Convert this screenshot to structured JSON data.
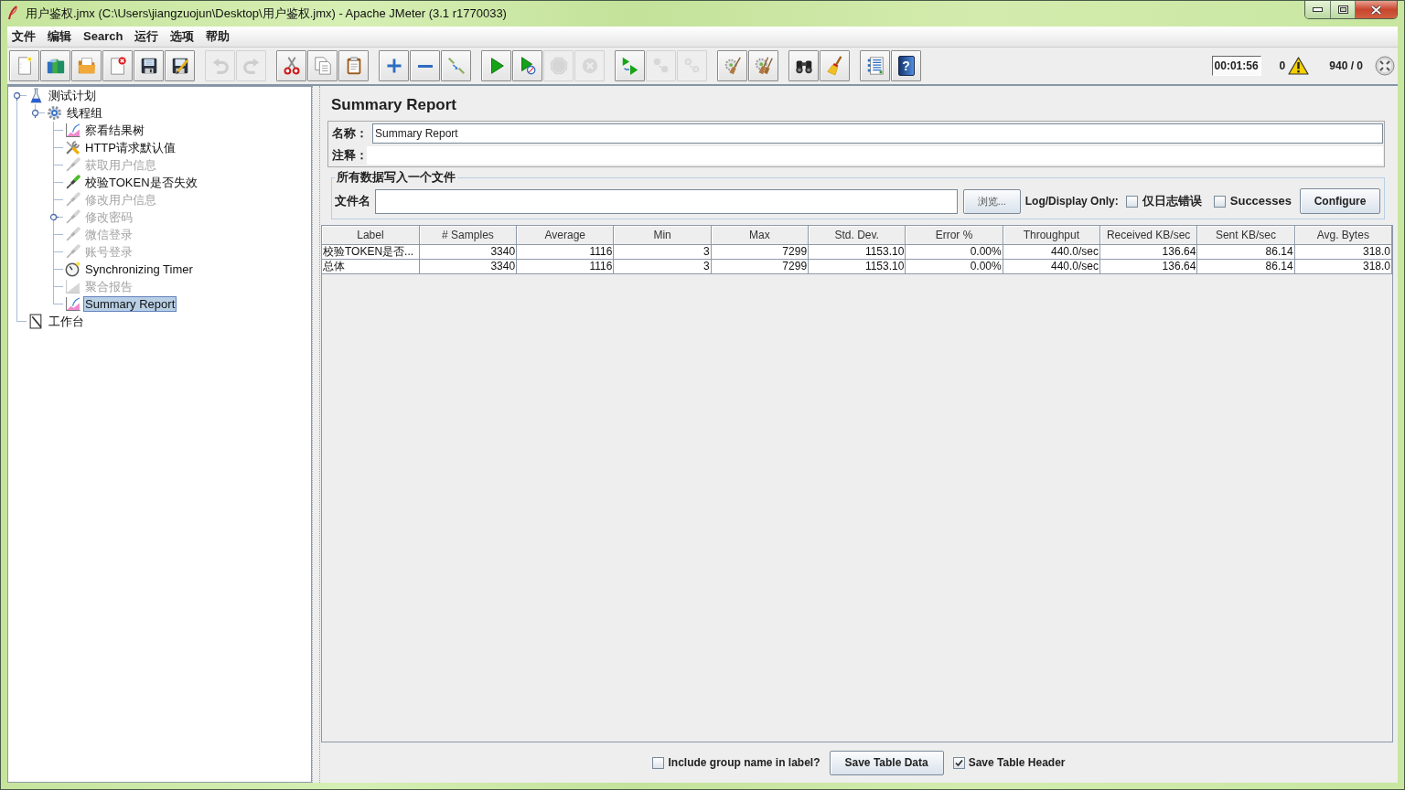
{
  "window": {
    "title": "用户鉴权.jmx (C:\\Users\\jiangzuojun\\Desktop\\用户鉴权.jmx) - Apache JMeter (3.1 r1770033)"
  },
  "menu": [
    "文件",
    "编辑",
    "Search",
    "运行",
    "选项",
    "帮助"
  ],
  "toolbar": {
    "groups": [
      [
        {
          "kind": "new",
          "disabled": false
        },
        {
          "kind": "templates",
          "disabled": false
        },
        {
          "kind": "open",
          "disabled": false
        },
        {
          "kind": "close",
          "disabled": false
        },
        {
          "kind": "save",
          "disabled": false
        },
        {
          "kind": "save_as",
          "disabled": false
        }
      ],
      [
        {
          "kind": "undo",
          "disabled": true
        },
        {
          "kind": "redo",
          "disabled": true
        }
      ],
      [
        {
          "kind": "cut",
          "disabled": false
        },
        {
          "kind": "copy",
          "disabled": false
        },
        {
          "kind": "paste",
          "disabled": false
        }
      ],
      [
        {
          "kind": "expand",
          "disabled": false
        },
        {
          "kind": "collapse",
          "disabled": false
        },
        {
          "kind": "toggle",
          "disabled": false
        }
      ],
      [
        {
          "kind": "start",
          "disabled": false
        },
        {
          "kind": "start_no_pauses",
          "disabled": false
        },
        {
          "kind": "stop",
          "disabled": true
        },
        {
          "kind": "shutdown",
          "disabled": true
        }
      ],
      [
        {
          "kind": "remote_start",
          "disabled": false
        },
        {
          "kind": "remote_stop",
          "disabled": true
        },
        {
          "kind": "remote_shutdown",
          "disabled": true
        }
      ],
      [
        {
          "kind": "clear",
          "disabled": false
        },
        {
          "kind": "clear_all",
          "disabled": false
        }
      ],
      [
        {
          "kind": "search",
          "disabled": false
        },
        {
          "kind": "reset_search",
          "disabled": false
        }
      ],
      [
        {
          "kind": "function_helper",
          "disabled": false
        },
        {
          "kind": "help",
          "disabled": false,
          "glyph": "?"
        }
      ]
    ],
    "elapsed": "00:01:56",
    "error_count": "0",
    "threads": "940 / 0"
  },
  "tree": [
    {
      "label": "测试计划",
      "kind": "test_plan",
      "disabled": false,
      "selected": false,
      "expanded": true,
      "children": [
        {
          "label": "线程组",
          "kind": "thread_group",
          "disabled": false,
          "selected": false,
          "expanded": true,
          "children": [
            {
              "label": "察看结果树",
              "kind": "listener",
              "disabled": false,
              "selected": false
            },
            {
              "label": "HTTP请求默认值",
              "kind": "config",
              "disabled": false,
              "selected": false
            },
            {
              "label": "获取用户信息",
              "kind": "sampler",
              "disabled": true,
              "selected": false
            },
            {
              "label": "校验TOKEN是否失效",
              "kind": "sampler",
              "disabled": false,
              "selected": false
            },
            {
              "label": "修改用户信息",
              "kind": "sampler",
              "disabled": true,
              "selected": false
            },
            {
              "label": "修改密码",
              "kind": "sampler",
              "disabled": true,
              "selected": false,
              "expanded": false
            },
            {
              "label": "微信登录",
              "kind": "sampler",
              "disabled": true,
              "selected": false
            },
            {
              "label": "账号登录",
              "kind": "sampler",
              "disabled": true,
              "selected": false
            },
            {
              "label": "Synchronizing Timer",
              "kind": "timer",
              "disabled": false,
              "selected": false
            },
            {
              "label": "聚合报告",
              "kind": "aggregate",
              "disabled": true,
              "selected": false
            },
            {
              "label": "Summary Report",
              "kind": "listener",
              "disabled": false,
              "selected": true
            }
          ]
        }
      ]
    },
    {
      "label": "工作台",
      "kind": "workbench",
      "disabled": false,
      "selected": false
    }
  ],
  "report": {
    "title": "Summary Report",
    "name_label": "名称：",
    "name_value": "Summary Report",
    "comment_label": "注释：",
    "file_group": {
      "title": "所有数据写入一个文件",
      "filename_label": "文件名",
      "browse_button": "浏览...",
      "log_label": "Log/Display Only:",
      "options": [
        {
          "label": "仅日志错误",
          "checked": false
        },
        {
          "label": "Successes",
          "checked": false
        }
      ],
      "configure_button": "Configure"
    },
    "table": {
      "columns": [
        "Label",
        "# Samples",
        "Average",
        "Min",
        "Max",
        "Std. Dev.",
        "Error %",
        "Throughput",
        "Received KB/sec",
        "Sent KB/sec",
        "Avg. Bytes"
      ],
      "rows": [
        [
          "校验TOKEN是否...",
          "3340",
          "1116",
          "3",
          "7299",
          "1153.10",
          "0.00%",
          "440.0/sec",
          "136.64",
          "86.14",
          "318.0"
        ],
        [
          "总体",
          "3340",
          "1116",
          "3",
          "7299",
          "1153.10",
          "0.00%",
          "440.0/sec",
          "136.64",
          "86.14",
          "318.0"
        ]
      ]
    },
    "footer": [
      {
        "kind": "checkbox",
        "label": "Include group name in label?",
        "checked": false
      },
      {
        "kind": "button",
        "label": "Save Table Data"
      },
      {
        "kind": "checkbox",
        "label": "Save Table Header",
        "checked": true
      }
    ]
  }
}
